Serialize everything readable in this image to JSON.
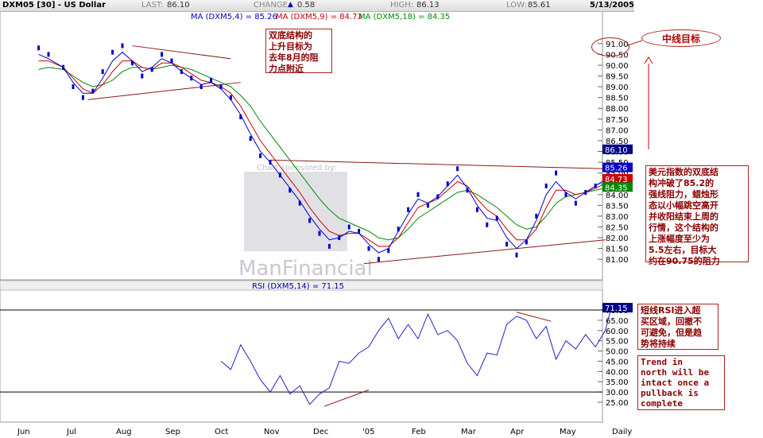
{
  "header": {
    "symbol": "DXM05 [30] - US Dollar",
    "last_label": "LAST:",
    "last_value": "86.10",
    "change_label": "CHANGE",
    "change_value": "0.58",
    "high_label": "HIGH:",
    "high_value": "86.13",
    "low_label": "LOW:",
    "low_value": "85.61",
    "date": "5/13/2005"
  },
  "colors": {
    "price": "#0000cc",
    "ma4": "#0000cc",
    "ma9": "#cc0000",
    "ma18": "#008800",
    "rsi": "#2222cc",
    "annotation": "#b02020",
    "last_badge": "#000088"
  },
  "chart_data": [
    {
      "type": "line",
      "title": "DXM05 [30] - US Dollar",
      "legend": [
        {
          "name": "MA (DXM5,4) = 85.26",
          "color": "#0000cc"
        },
        {
          "name": "MA (DXM5,9) = 84.73",
          "color": "#cc0000"
        },
        {
          "name": "MA (DXM5,18) = 84.35",
          "color": "#008800"
        }
      ],
      "x_ticks": [
        "Jun",
        "Jul",
        "Aug",
        "Sep",
        "Oct",
        "Nov",
        "Dec",
        "'05",
        "Feb",
        "Mar",
        "Apr",
        "May",
        "Daily"
      ],
      "y_ticks": [
        "81.00",
        "81.50",
        "82.00",
        "82.50",
        "83.00",
        "83.50",
        "84.00",
        "84.50",
        "85.00",
        "85.50",
        "86.00",
        "86.50",
        "87.00",
        "87.50",
        "88.00",
        "88.50",
        "89.00",
        "89.50",
        "90.00",
        "90.50",
        "91.00"
      ],
      "ylim": [
        80.6,
        91.4
      ],
      "price_x": [
        0.3,
        0.5,
        0.8,
        1.0,
        1.2,
        1.4,
        1.6,
        1.8,
        2.0,
        2.2,
        2.4,
        2.6,
        2.8,
        3.0,
        3.2,
        3.4,
        3.6,
        3.8,
        4.0,
        4.2,
        4.4,
        4.6,
        4.8,
        5.0,
        5.2,
        5.4,
        5.6,
        5.8,
        6.0,
        6.2,
        6.4,
        6.6,
        6.8,
        7.0,
        7.2,
        7.4,
        7.6,
        7.8,
        8.0,
        8.2,
        8.4,
        8.6,
        8.8,
        9.0,
        9.2,
        9.4,
        9.6,
        9.8,
        10.0,
        10.2,
        10.4,
        10.6,
        10.8,
        11.0,
        11.2,
        11.4,
        11.6,
        11.8,
        11.92
      ],
      "price": [
        90.8,
        90.5,
        89.9,
        89.0,
        88.5,
        88.8,
        89.7,
        90.6,
        90.9,
        90.1,
        89.5,
        89.8,
        90.5,
        90.2,
        89.7,
        89.4,
        89.0,
        89.3,
        89.0,
        88.5,
        87.6,
        86.6,
        85.8,
        85.5,
        84.9,
        84.2,
        83.6,
        82.8,
        82.2,
        81.6,
        82.0,
        82.5,
        82.3,
        81.5,
        81.0,
        81.4,
        82.4,
        83.3,
        84.0,
        83.5,
        83.9,
        84.5,
        85.2,
        84.2,
        83.3,
        82.6,
        82.9,
        81.7,
        81.2,
        81.8,
        83.0,
        84.4,
        85.0,
        84.0,
        83.6,
        84.1,
        84.4,
        84.6,
        86.1
      ],
      "ma4": [
        90.5,
        90.3,
        89.9,
        89.2,
        88.7,
        88.7,
        89.4,
        90.2,
        90.6,
        90.2,
        89.7,
        89.9,
        90.3,
        90.1,
        89.7,
        89.4,
        89.1,
        89.2,
        88.9,
        88.4,
        87.7,
        86.8,
        86.0,
        85.5,
        84.9,
        84.3,
        83.7,
        83.0,
        82.4,
        81.9,
        82.0,
        82.3,
        82.2,
        81.7,
        81.3,
        81.5,
        82.3,
        83.1,
        83.8,
        83.6,
        83.9,
        84.4,
        84.9,
        84.3,
        83.5,
        82.9,
        82.8,
        82.0,
        81.5,
        81.9,
        82.8,
        84.0,
        84.6,
        84.1,
        83.8,
        84.1,
        84.4,
        84.7,
        85.26
      ],
      "ma9": [
        90.2,
        90.2,
        89.9,
        89.4,
        88.9,
        88.7,
        89.1,
        89.7,
        90.2,
        90.2,
        89.9,
        89.8,
        90.1,
        90.1,
        89.9,
        89.6,
        89.3,
        89.2,
        89.0,
        88.7,
        88.1,
        87.3,
        86.5,
        85.9,
        85.3,
        84.7,
        84.1,
        83.4,
        82.8,
        82.3,
        82.1,
        82.2,
        82.2,
        81.9,
        81.6,
        81.6,
        82.0,
        82.7,
        83.4,
        83.6,
        83.8,
        84.2,
        84.6,
        84.4,
        83.8,
        83.3,
        83.0,
        82.4,
        81.9,
        81.9,
        82.4,
        83.4,
        84.2,
        84.2,
        84.0,
        84.1,
        84.3,
        84.5,
        84.73
      ],
      "ma18": [
        89.8,
        89.9,
        89.8,
        89.5,
        89.2,
        89.0,
        89.1,
        89.3,
        89.7,
        89.9,
        89.9,
        89.8,
        89.9,
        90.0,
        89.9,
        89.8,
        89.6,
        89.4,
        89.2,
        89.0,
        88.6,
        88.1,
        87.4,
        86.8,
        86.2,
        85.6,
        85.0,
        84.4,
        83.8,
        83.3,
        82.9,
        82.7,
        82.5,
        82.3,
        82.0,
        81.9,
        82.0,
        82.4,
        82.9,
        83.2,
        83.5,
        83.8,
        84.1,
        84.2,
        84.0,
        83.7,
        83.4,
        83.0,
        82.6,
        82.4,
        82.5,
        83.0,
        83.6,
        83.9,
        84.0,
        84.1,
        84.2,
        84.3,
        84.35
      ],
      "trendlines": [
        {
          "from": [
            2.2,
            90.9
          ],
          "to": [
            4.2,
            90.3
          ]
        },
        {
          "from": [
            1.3,
            88.4
          ],
          "to": [
            4.4,
            89.2
          ]
        },
        {
          "from": [
            5.0,
            85.6
          ],
          "to": [
            11.8,
            85.2
          ]
        },
        {
          "from": [
            6.9,
            80.8
          ],
          "to": [
            11.8,
            81.9
          ]
        }
      ],
      "last_price": "86.10",
      "ma_badges": [
        "85.26",
        "84.73",
        "84.35"
      ],
      "watermark": [
        "Chart sponsored by:",
        "ManFinancial"
      ]
    },
    {
      "type": "line",
      "title": "RSI (DXM5,14) = 71.15",
      "y_ticks": [
        "25.00",
        "30.00",
        "35.00",
        "40.00",
        "45.00",
        "50.00",
        "55.00",
        "60.00",
        "65.00",
        "70.00"
      ],
      "ylim": [
        21.5,
        73.5
      ],
      "rsi_x": [
        4.0,
        4.2,
        4.4,
        4.6,
        4.8,
        5.0,
        5.2,
        5.4,
        5.6,
        5.8,
        6.0,
        6.2,
        6.4,
        6.6,
        6.8,
        7.0,
        7.2,
        7.4,
        7.6,
        7.8,
        8.0,
        8.2,
        8.4,
        8.6,
        8.8,
        9.0,
        9.2,
        9.4,
        9.6,
        9.8,
        10.0,
        10.2,
        10.4,
        10.6,
        10.8,
        11.0,
        11.2,
        11.4,
        11.6,
        11.8,
        11.92
      ],
      "rsi": [
        45.0,
        41.0,
        53.0,
        45.0,
        36.0,
        30.0,
        38.0,
        29.0,
        33.0,
        24.0,
        29.0,
        32.0,
        45.0,
        44.0,
        49.0,
        52.0,
        60.0,
        66.0,
        56.0,
        63.0,
        56.0,
        68.0,
        58.0,
        60.0,
        55.0,
        44.0,
        38.0,
        49.0,
        48.0,
        63.0,
        67.0,
        65.0,
        56.0,
        62.0,
        46.0,
        55.0,
        51.0,
        58.0,
        52.0,
        60.0,
        71.15
      ],
      "levels": [
        70,
        30
      ],
      "trendlines": [
        {
          "from": [
            6.1,
            23.0
          ],
          "to": [
            7.0,
            31.0
          ]
        },
        {
          "from": [
            10.0,
            69.0
          ],
          "to": [
            10.7,
            64.5
          ]
        }
      ],
      "last_value": "71.15"
    }
  ],
  "annotations": {
    "double_bottom_target": "双底结构的\n上升目标为\n去年8月的阻\n力点附近",
    "mid_target": "中线目标",
    "dollar_index": "美元指数的双底结\n构冲破了85.2的\n强线阻力，蜡烛形\n态以小幅跳空高开\n并收阳结束上周的\n行情，这个结构的\n上涨幅度至少为\n5.5左右，目标大\n约在90.75的阻力",
    "rsi_note": "短线RSI进入超\n买区域，回撤不\n可避免，但是趋\n势将持续",
    "trend_note": "Trend in\nnorth will be\nintact once a\npullback is\ncomplete"
  }
}
